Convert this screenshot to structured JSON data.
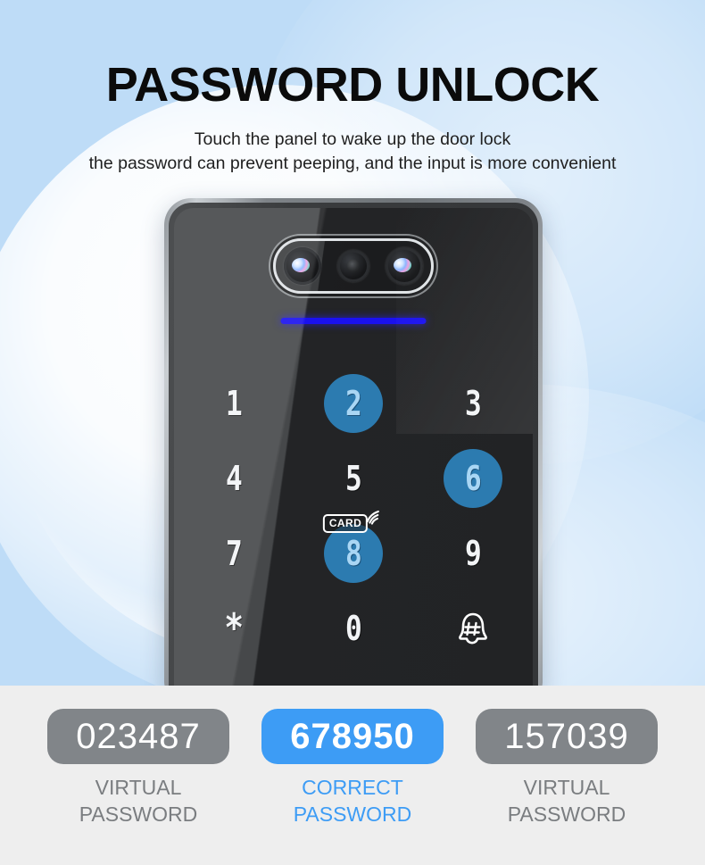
{
  "hero": {
    "title": "PASSWORD UNLOCK",
    "subtitle_line1": "Touch the panel to wake up the door lock",
    "subtitle_line2": "the password can prevent peeping, and the input is more convenient",
    "background_color": "#bedcf7",
    "title_color": "#0b0b0b"
  },
  "device": {
    "indicator_color": "#1a11ef",
    "glass_color": "#232426",
    "frame_color": "#8f9499",
    "active_key_color": "#2c7bb0",
    "active_digit_color": "#a9d6f4",
    "idle_digit_color": "#f2f4f6",
    "card_badge_label": "CARD",
    "keypad": [
      {
        "label": "1",
        "active": false,
        "name": "key-1"
      },
      {
        "label": "2",
        "active": true,
        "name": "key-2"
      },
      {
        "label": "3",
        "active": false,
        "name": "key-3"
      },
      {
        "label": "4",
        "active": false,
        "name": "key-4"
      },
      {
        "label": "5",
        "active": false,
        "name": "key-5"
      },
      {
        "label": "6",
        "active": true,
        "name": "key-6"
      },
      {
        "label": "7",
        "active": false,
        "name": "key-7"
      },
      {
        "label": "8",
        "active": true,
        "name": "key-8"
      },
      {
        "label": "9",
        "active": false,
        "name": "key-9"
      },
      {
        "label": "*",
        "active": false,
        "name": "key-star"
      },
      {
        "label": "0",
        "active": false,
        "name": "key-0"
      },
      {
        "label": "",
        "active": false,
        "name": "key-bell"
      }
    ]
  },
  "bottom": {
    "background_color": "#eeeeee",
    "virtual_box_color": "#818589",
    "correct_box_color": "#3d9cf5",
    "virtual_label_color": "#7a7d80",
    "correct_label_color": "#3d9cf5",
    "passwords": [
      {
        "value": "023487",
        "label_line1": "VIRTUAL",
        "label_line2": "PASSWORD",
        "type": "virtual"
      },
      {
        "value": "678950",
        "label_line1": "CORRECT",
        "label_line2": "PASSWORD",
        "type": "correct"
      },
      {
        "value": "157039",
        "label_line1": "VIRTUAL",
        "label_line2": "PASSWORD",
        "type": "virtual"
      }
    ]
  }
}
